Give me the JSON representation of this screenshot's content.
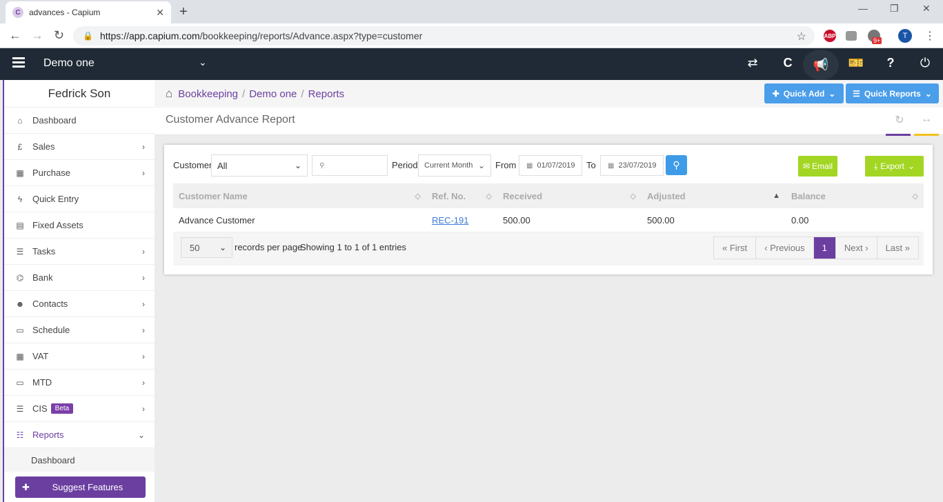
{
  "browser": {
    "tab_title": "advances - Capium",
    "tab_close": "✕",
    "favicon": "C",
    "url_host": "https://app.capium.com",
    "url_path": "/bookkeeping/reports/Advance.aspx?type=customer",
    "ext_abp": "ABP",
    "ext_badge": "9+",
    "avatar_letter": "T"
  },
  "header": {
    "company": "Demo one"
  },
  "sidebar": {
    "user": "Fedrick Son",
    "items": [
      {
        "label": "Dashboard",
        "icon": "home-icon",
        "glyph": "⌂",
        "chevron": false
      },
      {
        "label": "Sales",
        "icon": "pound-icon",
        "glyph": "£",
        "chevron": true
      },
      {
        "label": "Purchase",
        "icon": "grid-icon",
        "glyph": "▦",
        "chevron": true
      },
      {
        "label": "Quick Entry",
        "icon": "bolt-icon",
        "glyph": "ϟ",
        "chevron": false
      },
      {
        "label": "Fixed Assets",
        "icon": "building-icon",
        "glyph": "▤",
        "chevron": false
      },
      {
        "label": "Tasks",
        "icon": "tasks-icon",
        "glyph": "☰",
        "chevron": true
      },
      {
        "label": "Bank",
        "icon": "bank-icon",
        "glyph": "⌬",
        "chevron": true
      },
      {
        "label": "Contacts",
        "icon": "users-icon",
        "glyph": "☻",
        "chevron": true
      },
      {
        "label": "Schedule",
        "icon": "calendar-icon",
        "glyph": "▭",
        "chevron": true
      },
      {
        "label": "VAT",
        "icon": "calculator-icon",
        "glyph": "▦",
        "chevron": true
      },
      {
        "label": "MTD",
        "icon": "calendar-icon",
        "glyph": "▭",
        "chevron": true
      },
      {
        "label": "CIS",
        "icon": "indent-icon",
        "glyph": "☰",
        "chevron": true,
        "badge": "Beta"
      },
      {
        "label": "Reports",
        "icon": "list-icon",
        "glyph": "☷",
        "chevron": true,
        "active": true
      }
    ],
    "sub_item": "Dashboard",
    "suggest": "Suggest Features"
  },
  "breadcrumb": {
    "items": [
      "Bookkeeping",
      "Demo one",
      "Reports"
    ],
    "separator": "/"
  },
  "actions": {
    "quick_add": "Quick Add",
    "quick_reports": "Quick Reports"
  },
  "page": {
    "title": "Customer Advance Report"
  },
  "filters": {
    "customer_label": "Customer",
    "customer_value": "All",
    "search_value": "",
    "period_label": "Period",
    "period_value": "Current Month",
    "from_label": "From",
    "from_value": "01/07/2019",
    "to_label": "To",
    "to_value": "23/07/2019",
    "email": "Email",
    "export": "Export"
  },
  "table": {
    "columns": [
      "Customer Name",
      "Ref. No.",
      "Received",
      "Adjusted",
      "Balance"
    ],
    "rows": [
      {
        "customer": "Advance Customer",
        "ref": "REC-191",
        "received": "500.00",
        "adjusted": "500.00",
        "balance": "0.00"
      }
    ],
    "page_size": "50",
    "records_label": "records per page",
    "info": "Showing 1 to 1 of 1 entries",
    "pager": {
      "first": "« First",
      "previous": "‹ Previous",
      "current": "1",
      "next": "Next ›",
      "last": "Last »"
    }
  }
}
